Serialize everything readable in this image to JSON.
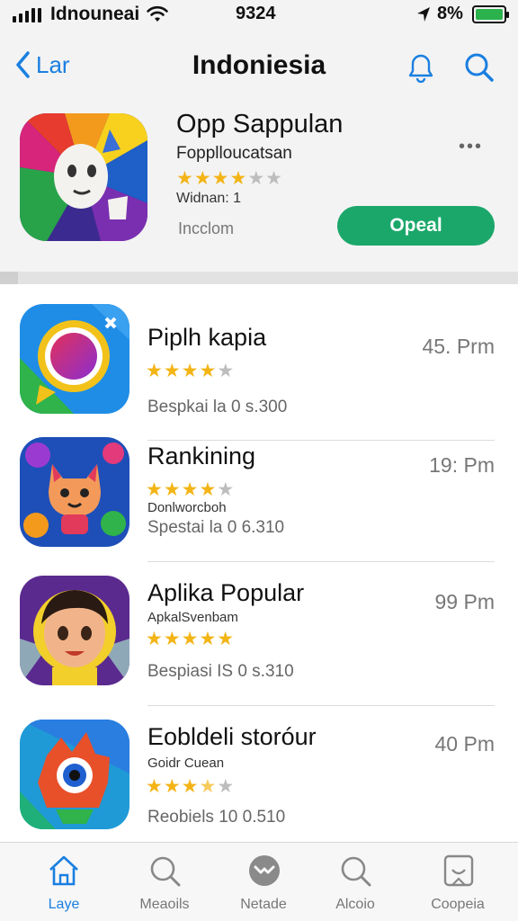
{
  "status_bar": {
    "carrier": "Idnouneai",
    "time": "9324",
    "battery": "8%",
    "colors": {
      "battery_fill": "#2bb24c"
    }
  },
  "nav": {
    "back_label": "Lar",
    "title": "Indoniesia",
    "icons": [
      "chevron-left-icon",
      "bell-icon",
      "search-icon"
    ]
  },
  "featured": {
    "name": "Opp Sappulan",
    "subtitle": "Fopplloucatsan",
    "rating": 3.5,
    "version": "Widnan: 1",
    "developer": "Incclom",
    "open_label": "Opeal",
    "more_label": "•••",
    "colors": {
      "open_button": "#1ba76a"
    }
  },
  "apps": [
    {
      "name": "Piplh kapia",
      "subtitle": "",
      "rating": 4,
      "meta": "Bespkai la 0 s.300",
      "price": "45. Prm"
    },
    {
      "name": "Rankining",
      "subtitle": "Donlworcboh",
      "rating": 4,
      "meta": "Spestai la 0 6.310",
      "price": "19: Pm"
    },
    {
      "name": "Aplika Popular",
      "subtitle": "ApkalSvenbam",
      "rating": 5,
      "meta": "Bespiasi IS 0 s.310",
      "price": "99 Pm"
    },
    {
      "name": "Eobldeli storóur",
      "subtitle": "Goidr Cuean",
      "rating": 3.5,
      "meta": "Reobiels 10 0.510",
      "price": "40 Pm"
    }
  ],
  "tabs": [
    {
      "label": "Laye",
      "icon": "home-icon",
      "active": true
    },
    {
      "label": "Meaoils",
      "icon": "search-icon",
      "active": false
    },
    {
      "label": "Netade",
      "icon": "games-icon",
      "active": false
    },
    {
      "label": "Alcoio",
      "icon": "search-icon",
      "active": false
    },
    {
      "label": "Coopeia",
      "icon": "updates-icon",
      "active": false
    }
  ],
  "colors": {
    "accent": "#1a7fe0",
    "star": "#f3b416",
    "star_empty": "#bdbdbd"
  }
}
